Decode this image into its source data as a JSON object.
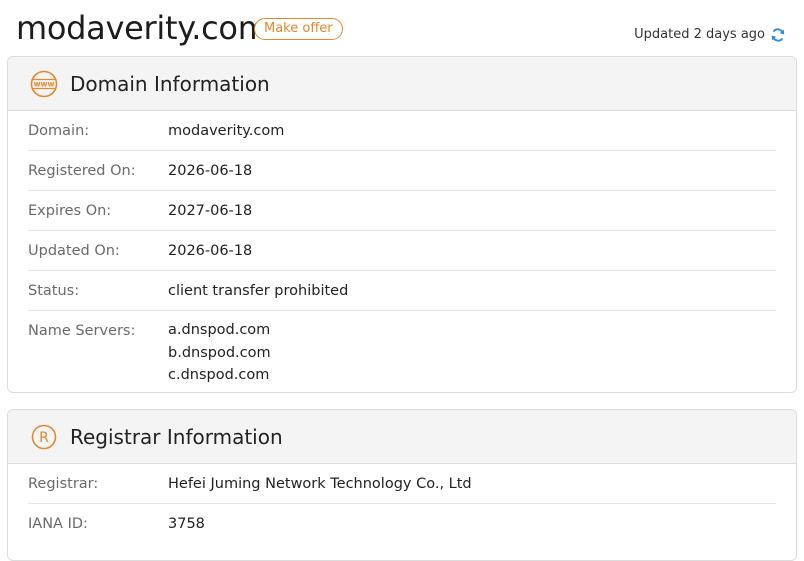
{
  "header": {
    "domain": "modaverity.com",
    "offer_label": "Make offer",
    "updated_text": "Updated 2 days ago"
  },
  "domain_panel": {
    "title": "Domain Information",
    "icon": "www-icon",
    "rows": [
      {
        "label": "Domain:",
        "value": "modaverity.com"
      },
      {
        "label": "Registered On:",
        "value": "2026-06-18"
      },
      {
        "label": "Expires On:",
        "value": "2027-06-18"
      },
      {
        "label": "Updated On:",
        "value": "2026-06-18"
      },
      {
        "label": "Status:",
        "value": "client transfer prohibited"
      }
    ],
    "name_servers_label": "Name Servers:",
    "name_servers": [
      "a.dnspod.com",
      "b.dnspod.com",
      "c.dnspod.com"
    ]
  },
  "registrar_panel": {
    "title": "Registrar Information",
    "icon": "registered-icon",
    "rows": [
      {
        "label": "Registrar:",
        "value": "Hefei Juming Network Technology Co., Ltd"
      },
      {
        "label": "IANA ID:",
        "value": "3758"
      }
    ]
  },
  "colors": {
    "accent": "#e0892f",
    "refresh": "#2a8ad8"
  }
}
